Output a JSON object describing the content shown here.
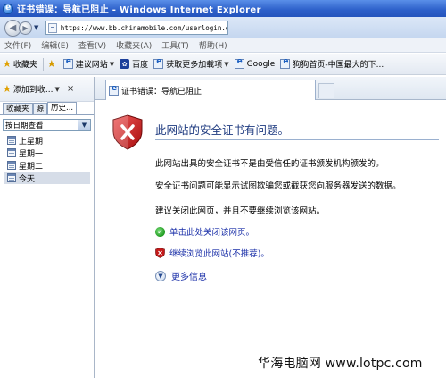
{
  "window": {
    "title": "证书错误：导航已阻止 - Windows Internet Explorer"
  },
  "address_bar": {
    "url": "https://www.bb.chinamobile.com/userlogin.do"
  },
  "menu": {
    "items": [
      "文件(F)",
      "编辑(E)",
      "查看(V)",
      "收藏夹(A)",
      "工具(T)",
      "帮助(H)"
    ]
  },
  "favorites_bar": {
    "favorites_label": "收藏夹",
    "links": [
      {
        "label": "建议网站",
        "icon": "ie-page-icon",
        "has_dropdown": true
      },
      {
        "label": "百度",
        "icon": "baidu-paw-icon",
        "has_dropdown": false
      },
      {
        "label": "获取更多加载项",
        "icon": "ie-page-icon",
        "has_dropdown": true
      },
      {
        "label": "Google",
        "icon": "ie-page-icon",
        "has_dropdown": false
      },
      {
        "label": "狗狗首页-中国最大的下...",
        "icon": "ie-page-icon",
        "has_dropdown": false
      }
    ]
  },
  "sidebar": {
    "add_to_favorites_label": "添加到收...",
    "close_label": "×",
    "tabs": [
      "收藏夹",
      "源",
      "历史..."
    ],
    "active_tab": "历史...",
    "view_select": "按日期查看",
    "history_items": [
      {
        "label": "上星期",
        "selected": false
      },
      {
        "label": "星期一",
        "selected": false
      },
      {
        "label": "星期二",
        "selected": false
      },
      {
        "label": "今天",
        "selected": true
      }
    ]
  },
  "tab": {
    "label": "证书错误：导航已阻止"
  },
  "content": {
    "headline": "此网站的安全证书有问题。",
    "paragraphs": [
      "此网站出具的安全证书不是由受信任的证书颁发机构颁发的。",
      "安全证书问题可能显示试图欺骗您或截获您向服务器发送的数据。",
      "建议关闭此网页，并且不要继续浏览该网站。"
    ],
    "actions": {
      "close_page": "单击此处关闭该网页。",
      "continue_site": "继续浏览此网站(不推荐)。"
    },
    "more_info": "更多信息"
  },
  "colors": {
    "titlebar": "#2c5fc9",
    "link": "#1a2fa8",
    "headline": "#1f3b80",
    "shield_red": "#c41a1a"
  },
  "watermark": {
    "text": "华海电脑网 www.lotpc.com"
  }
}
